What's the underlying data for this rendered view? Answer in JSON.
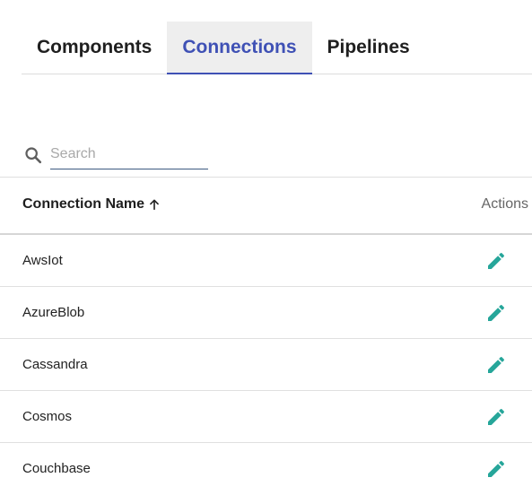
{
  "tabs": [
    {
      "label": "Components",
      "active": false
    },
    {
      "label": "Connections",
      "active": true
    },
    {
      "label": "Pipelines",
      "active": false
    }
  ],
  "search": {
    "placeholder": "Search",
    "value": "",
    "icon": "search-icon"
  },
  "table": {
    "columns": {
      "name": "Connection Name",
      "sort": "ascending",
      "actions": "Actions"
    },
    "rows": [
      {
        "name": "AwsIot",
        "action_icon": "edit-icon"
      },
      {
        "name": "AzureBlob",
        "action_icon": "edit-icon"
      },
      {
        "name": "Cassandra",
        "action_icon": "edit-icon"
      },
      {
        "name": "Cosmos",
        "action_icon": "edit-icon"
      },
      {
        "name": "Couchbase",
        "action_icon": "edit-icon"
      }
    ]
  },
  "colors": {
    "accent": "#3f51b5",
    "edit_icon": "#26a69a",
    "active_tab_bg": "#eeeeee"
  }
}
